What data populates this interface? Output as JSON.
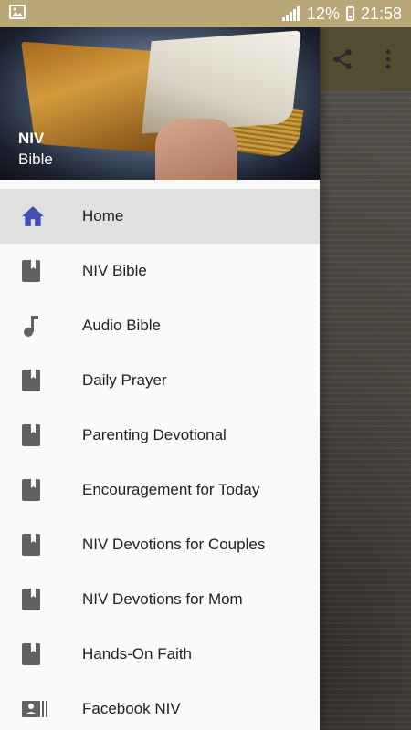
{
  "status_bar": {
    "battery_percent": "12%",
    "time": "21:58",
    "icons": [
      "image-icon",
      "signal-icon",
      "battery-charging-icon"
    ]
  },
  "toolbar": {
    "actions": [
      "share-icon",
      "more-vert-icon"
    ]
  },
  "drawer": {
    "header": {
      "title": "NIV",
      "subtitle": "Bible"
    },
    "items": [
      {
        "label": "Home",
        "icon": "home-icon",
        "active": true
      },
      {
        "label": "NIV Bible",
        "icon": "book-icon"
      },
      {
        "label": "Audio Bible",
        "icon": "music-note-icon"
      },
      {
        "label": "Daily Prayer",
        "icon": "book-icon"
      },
      {
        "label": "Parenting Devotional",
        "icon": "book-icon"
      },
      {
        "label": "Encouragement for Today",
        "icon": "book-icon"
      },
      {
        "label": "NIV Devotions for Couples",
        "icon": "book-icon"
      },
      {
        "label": "NIV Devotions for Mom",
        "icon": "book-icon"
      },
      {
        "label": "Hands-On Faith",
        "icon": "book-icon"
      },
      {
        "label": "Facebook NIV",
        "icon": "contact-card-icon"
      }
    ]
  },
  "colors": {
    "status_bar": "#b9a877",
    "active_icon": "#3f51b5",
    "inactive_icon": "#616161",
    "active_item_bg": "#e0e0e0"
  }
}
